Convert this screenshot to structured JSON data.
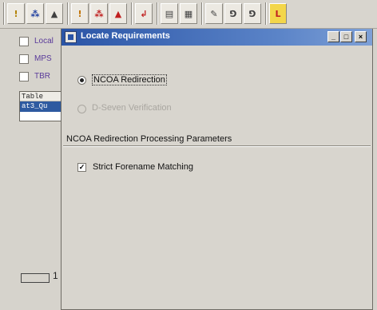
{
  "toolbar": {
    "buttons": [
      {
        "icon": "person-icon",
        "glyph": "!",
        "color": "#b08000"
      },
      {
        "icon": "chart-icon",
        "glyph": "⁂",
        "color": "#2040a0"
      },
      {
        "icon": "group-icon",
        "glyph": "▲",
        "color": "#404040"
      },
      {
        "icon": "person-highlight-icon",
        "glyph": "!",
        "color": "#c07000"
      },
      {
        "icon": "chart-red-icon",
        "glyph": "⁂",
        "color": "#c02020"
      },
      {
        "icon": "group-red-icon",
        "glyph": "▲",
        "color": "#c02020"
      },
      {
        "icon": "arrow-red-icon",
        "glyph": "↲",
        "color": "#c02020"
      },
      {
        "icon": "table-icon",
        "glyph": "▤",
        "color": "#404040"
      },
      {
        "icon": "grid-icon",
        "glyph": "▦",
        "color": "#404040"
      },
      {
        "icon": "edit-icon",
        "glyph": "✎",
        "color": "#404040"
      },
      {
        "icon": "layout-icon",
        "glyph": "⅁",
        "color": "#404040"
      },
      {
        "icon": "layout2-icon",
        "glyph": "⅁",
        "color": "#404040"
      },
      {
        "icon": "letter-l-icon",
        "glyph": "L",
        "color": "#c02020"
      }
    ]
  },
  "background": {
    "checks": [
      "Local",
      "MPS",
      "TBR"
    ],
    "table_header": "Table",
    "table_row": "at3_Qu",
    "bottom_text": "1"
  },
  "dialog": {
    "title": "Locate Requirements",
    "window_buttons": {
      "minimize": "_",
      "maximize": "□",
      "close": "×"
    },
    "options": [
      {
        "label": "NCOA Redirection",
        "checked": true,
        "enabled": true
      },
      {
        "label": "D-Seven Verification",
        "checked": false,
        "enabled": false
      }
    ],
    "group_title": "NCOA Redirection Processing Parameters",
    "strict_label": "Strict Forename Matching",
    "strict_checked": "✓"
  }
}
